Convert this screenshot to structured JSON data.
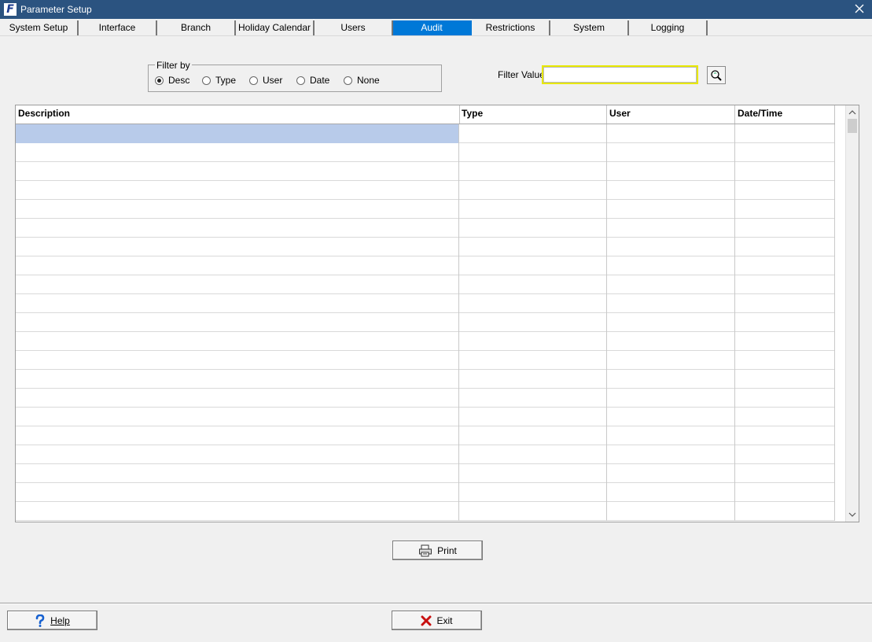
{
  "window": {
    "title": "Parameter Setup",
    "app_icon_letter": "F",
    "close_icon": "close-icon"
  },
  "tabs": [
    {
      "label": "System Setup",
      "active": false
    },
    {
      "label": "Interface",
      "active": false
    },
    {
      "label": "Branch",
      "active": false
    },
    {
      "label": "Holiday Calendar",
      "active": false
    },
    {
      "label": "Users",
      "active": false
    },
    {
      "label": "Audit",
      "active": true
    },
    {
      "label": "Restrictions",
      "active": false
    },
    {
      "label": "System",
      "active": false
    },
    {
      "label": "Logging",
      "active": false
    }
  ],
  "filter": {
    "group_label": "Filter by",
    "options": [
      {
        "label": "Desc",
        "checked": true
      },
      {
        "label": "Type",
        "checked": false
      },
      {
        "label": "User",
        "checked": false
      },
      {
        "label": "Date",
        "checked": false
      },
      {
        "label": "None",
        "checked": false
      }
    ],
    "value_label": "Filter Value",
    "value": "",
    "search_icon": "magnifier-icon"
  },
  "grid": {
    "columns": [
      "Description",
      "Type",
      "User",
      "Date/Time"
    ],
    "row_count": 21,
    "selected_row": 0
  },
  "buttons": {
    "print_label": "Print",
    "help_label": "Help",
    "exit_label": "Exit"
  },
  "colors": {
    "titlebar": "#2b5380",
    "active_tab": "#0078d7",
    "selection": "#b8cbea",
    "focus_border": "#e8e800"
  }
}
